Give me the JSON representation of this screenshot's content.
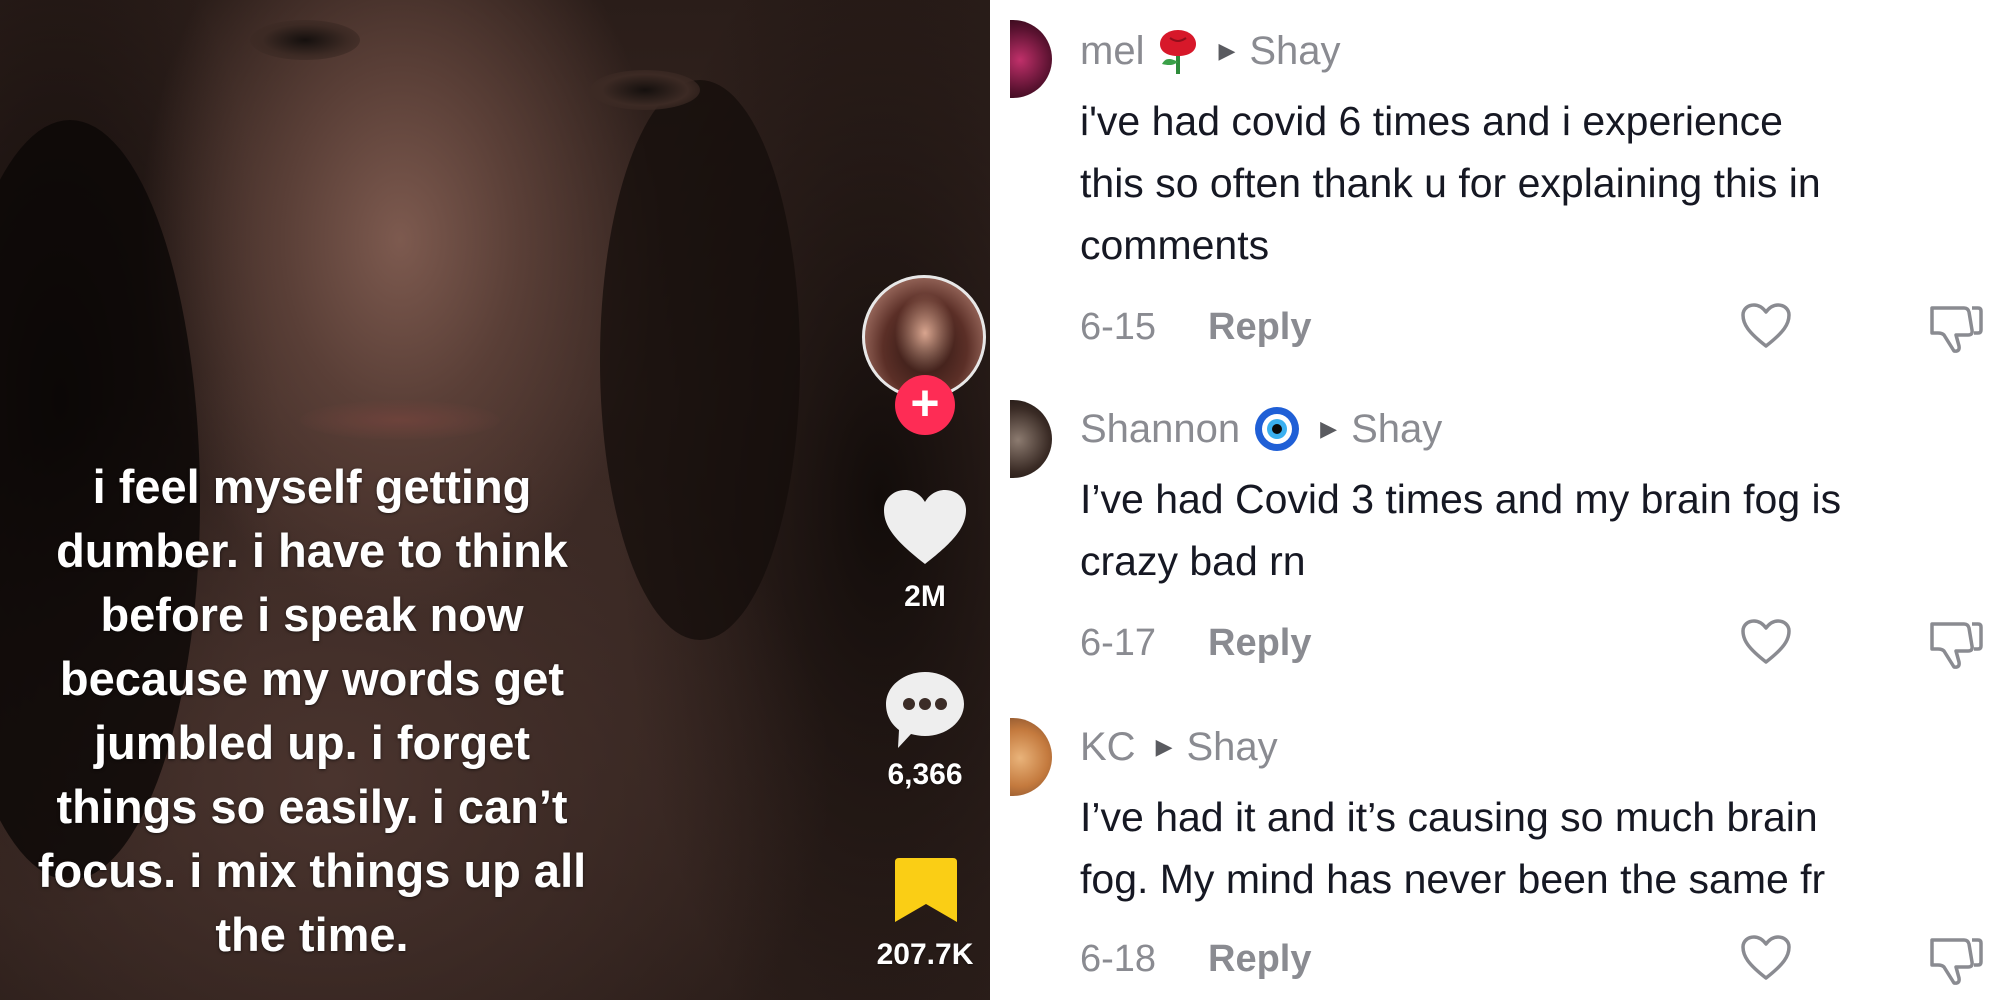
{
  "video": {
    "caption_lines": [
      "i feel myself getting",
      "dumber. i have to think",
      "before i speak now",
      "because my words get",
      "jumbled up. i forget",
      "things so easily. i can’t",
      "focus. i mix things up all",
      "the time."
    ],
    "follow_label": "+",
    "likes_count": "2M",
    "comments_count": "6,366",
    "saves_count": "207.7K",
    "icons": {
      "like": "heart-icon",
      "comment": "comment-bubble-icon",
      "save": "bookmark-icon"
    },
    "colors": {
      "follow_button": "#fe2c55",
      "bookmark": "#face15"
    }
  },
  "comments": [
    {
      "author": "mel",
      "emoji": "rose-emoji",
      "reply_to": "Shay",
      "lines": [
        "i've had covid 6 times and i experience",
        "this so often thank u for explaining this in",
        "comments"
      ],
      "date": "6-15",
      "reply_label": "Reply"
    },
    {
      "author": "Shannon",
      "emoji": "nazar-amulet-emoji",
      "reply_to": "Shay",
      "lines": [
        "I’ve had Covid 3 times and my brain fog is",
        "crazy bad rn"
      ],
      "date": "6-17",
      "reply_label": "Reply"
    },
    {
      "author": "KC",
      "emoji": "",
      "reply_to": "Shay",
      "lines": [
        "I’ve had it and it’s causing so much brain",
        "fog. My mind has never been the same fr"
      ],
      "date": "6-18",
      "reply_label": "Reply"
    }
  ]
}
